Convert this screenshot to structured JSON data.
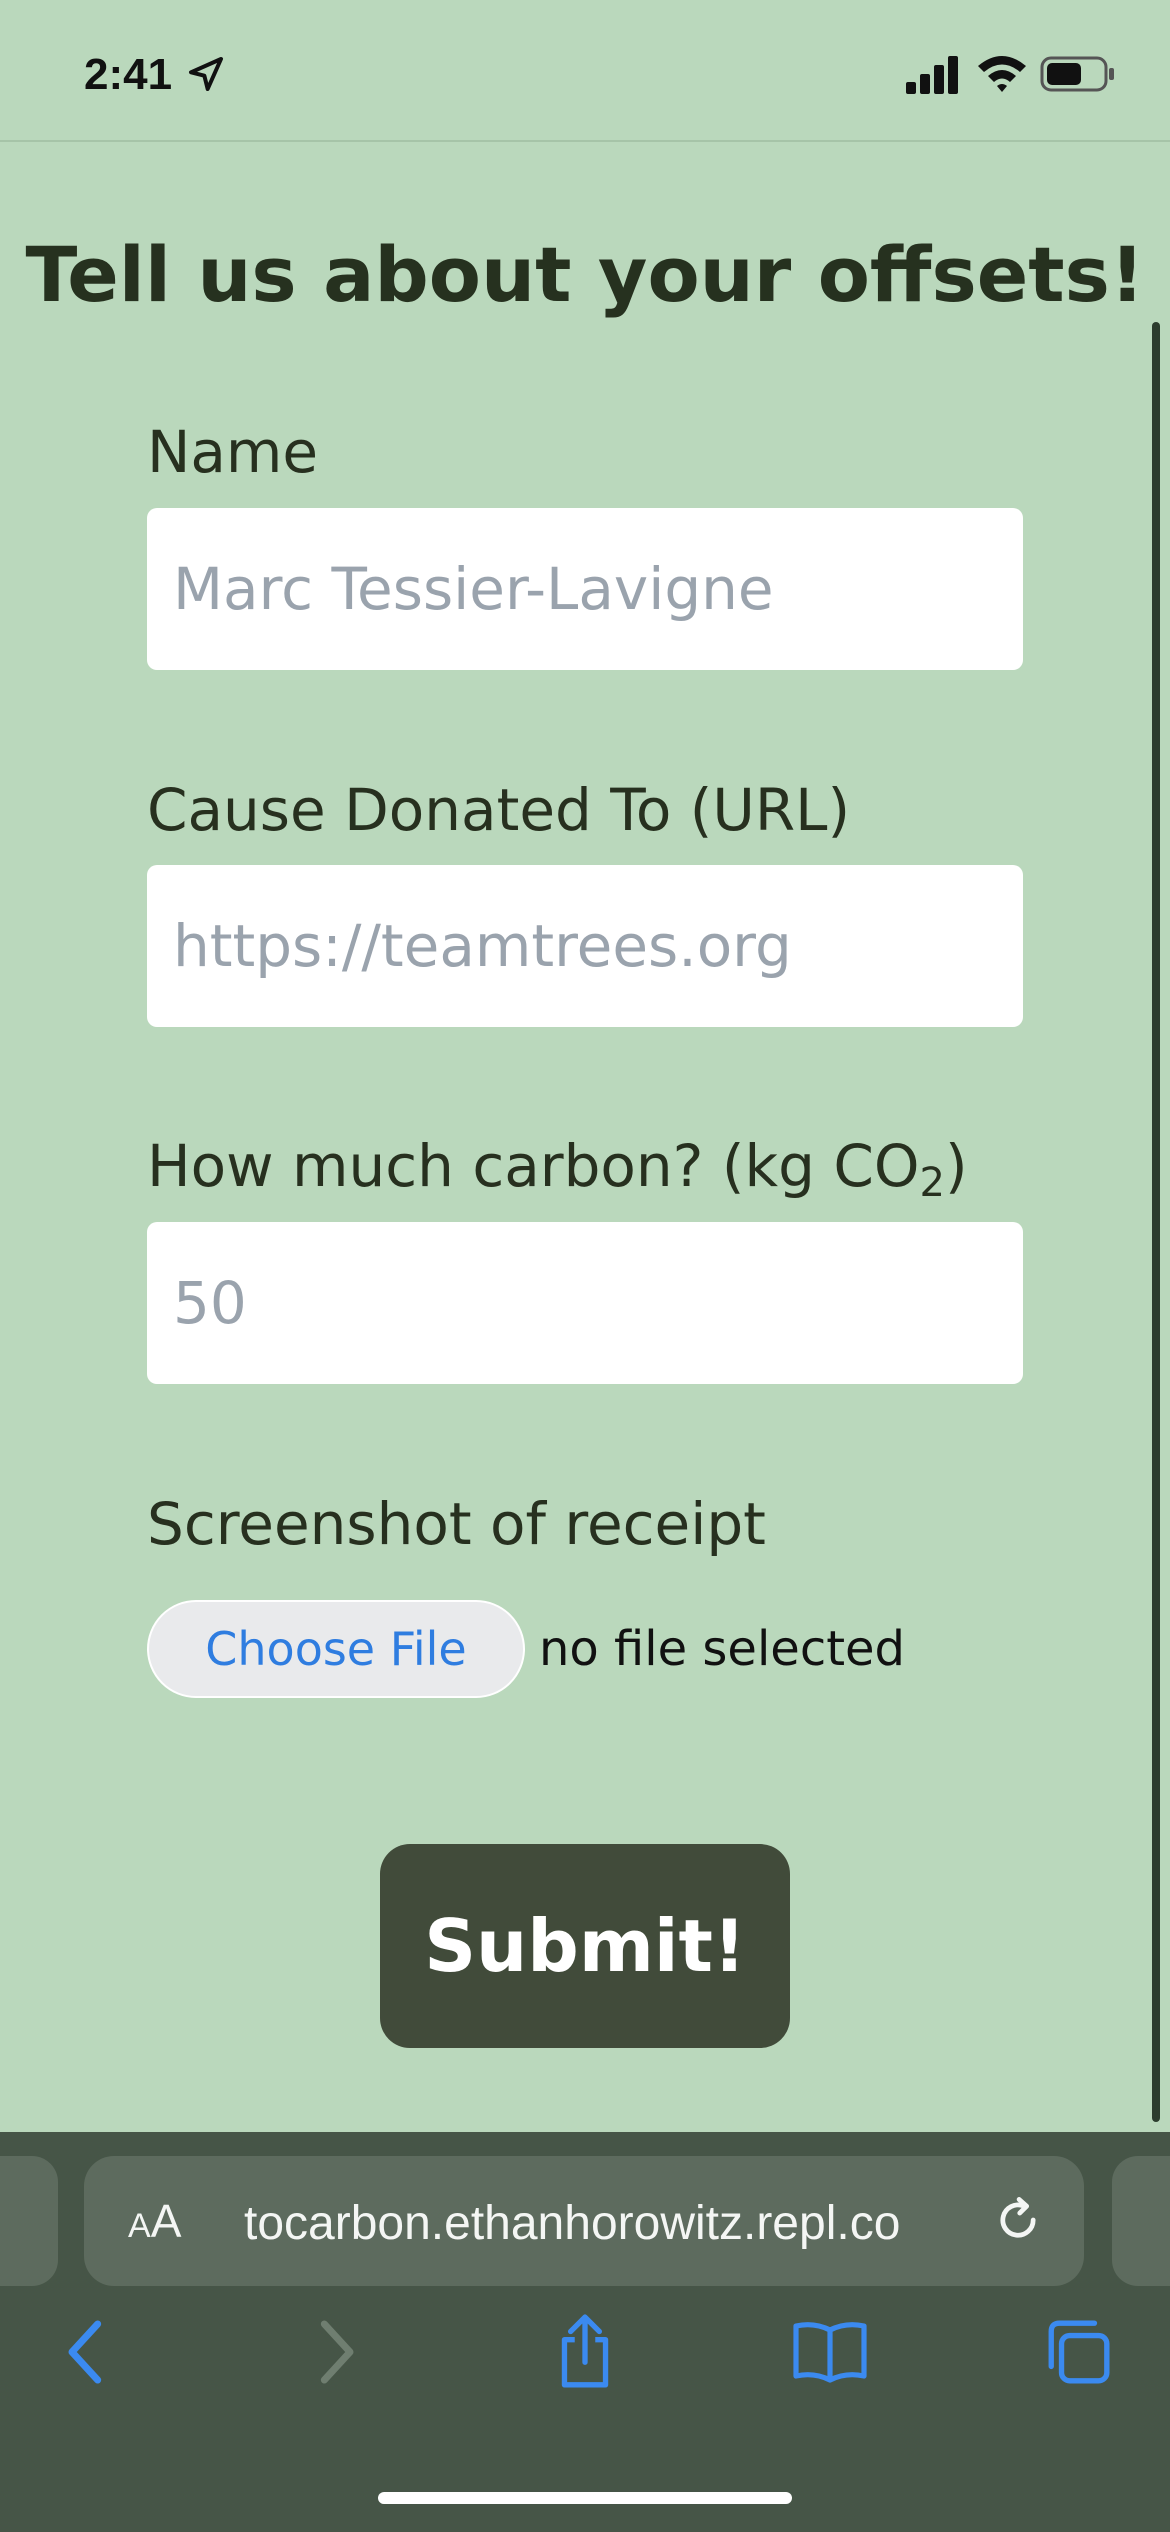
{
  "status_bar": {
    "time": "2:41"
  },
  "form": {
    "title": "Tell us about your offsets!",
    "name_label": "Name",
    "name_placeholder": "Marc Tessier-Lavigne",
    "cause_label": "Cause Donated To (URL)",
    "cause_placeholder": "https://teamtrees.org",
    "carbon_label_prefix": "How much carbon? (kg CO",
    "carbon_label_sub": "2",
    "carbon_label_suffix": ")",
    "carbon_placeholder": "50",
    "receipt_label": "Screenshot of receipt",
    "choose_file_label": "Choose File",
    "file_status": "no file selected",
    "submit_label": "Submit!"
  },
  "browser": {
    "aa_small": "A",
    "aa_big": "A",
    "url": "tocarbon.ethanhorowitz.repl.co"
  },
  "colors": {
    "background": "#bad8bc",
    "submit_button": "#414b3a",
    "browser_chrome": "#465547",
    "link_blue": "#2f7de0"
  }
}
